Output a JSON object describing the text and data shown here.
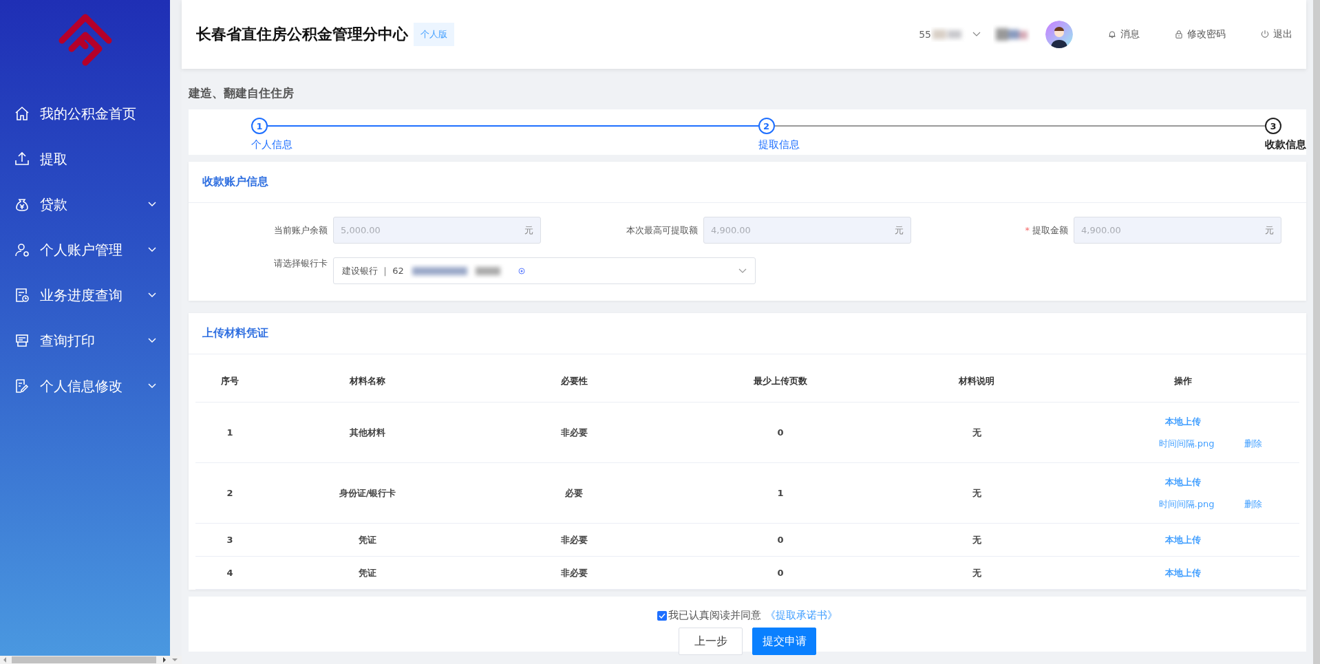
{
  "sidebar": {
    "items": [
      {
        "label": "我的公积金首页",
        "expandable": false
      },
      {
        "label": "提取",
        "expandable": false
      },
      {
        "label": "贷款",
        "expandable": true
      },
      {
        "label": "个人账户管理",
        "expandable": true
      },
      {
        "label": "业务进度查询",
        "expandable": true
      },
      {
        "label": "查询打印",
        "expandable": true
      },
      {
        "label": "个人信息修改",
        "expandable": true
      }
    ]
  },
  "header": {
    "title": "长春省直住房公积金管理分中心",
    "badge": "个人版",
    "account": "55",
    "actions": [
      {
        "label": "消息"
      },
      {
        "label": "修改密码"
      },
      {
        "label": "退出"
      }
    ]
  },
  "page_title": "建造、翻建自住住房",
  "steps": [
    {
      "number": "1",
      "label": "个人信息",
      "active": false
    },
    {
      "number": "2",
      "label": "提取信息",
      "active": false
    },
    {
      "number": "3",
      "label": "收款信息",
      "active": true
    }
  ],
  "account_section": {
    "title": "收款账户信息",
    "fields": [
      {
        "label": "当前账户余额",
        "value": "5,000.00",
        "unit": "元",
        "disabled": true
      },
      {
        "label": "本次最高可提取额",
        "value": "4,900.00",
        "unit": "元",
        "disabled": true
      },
      {
        "label": "提取金额",
        "required_mark": "*",
        "value": "4,900.00",
        "unit": "元",
        "disabled": true
      }
    ],
    "bank_select": {
      "label": "请选择银行卡",
      "value": "建设银行 ｜ 62"
    }
  },
  "materials_section": {
    "title": "上传材料凭证",
    "columns": [
      "序号",
      "材料名称",
      "必要性",
      "最少上传页数",
      "材料说明",
      "操作"
    ],
    "rows": [
      {
        "index": "1",
        "name": "其他材料",
        "necessity": "非必要",
        "min_pages": "0",
        "description": "无",
        "upload": "本地上传",
        "file": "时间间隔.png",
        "delete": "删除"
      },
      {
        "index": "2",
        "name": "身份证/银行卡",
        "necessity": "必要",
        "min_pages": "1",
        "description": "无",
        "upload": "本地上传",
        "file": "时间间隔.png",
        "delete": "删除"
      },
      {
        "index": "3",
        "name": "凭证",
        "necessity": "非必要",
        "min_pages": "0",
        "description": "无",
        "upload": "本地上传"
      },
      {
        "index": "4",
        "name": "凭证",
        "necessity": "非必要",
        "min_pages": "0",
        "description": "无",
        "upload": "本地上传"
      }
    ]
  },
  "agreement": {
    "checked": true,
    "text": "我已认真阅读并同意",
    "link": "《提取承诺书》"
  },
  "buttons": [
    {
      "label": "上一步",
      "kind": "default"
    },
    {
      "label": "提交申请",
      "kind": "primary"
    }
  ]
}
